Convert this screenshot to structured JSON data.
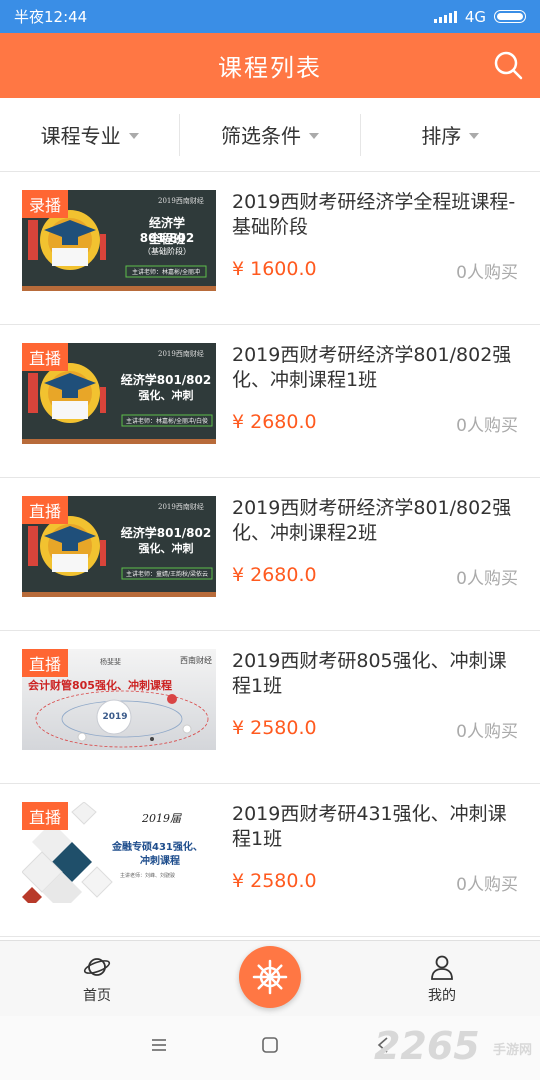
{
  "status_bar": {
    "time": "半夜12:44",
    "network": "4G"
  },
  "header": {
    "title": "课程列表"
  },
  "filters": [
    {
      "label": "课程专业"
    },
    {
      "label": "筛选条件"
    },
    {
      "label": "排序"
    }
  ],
  "courses": [
    {
      "tag": "录播",
      "title": "2019西财考研经济学全程班课程-基础阶段",
      "price": "¥  1600.0",
      "buyers": "0人购买",
      "thumb": {
        "headline": "经济学801/802",
        "sub1": "全程班",
        "sub2": "（基础阶段）",
        "teacher": "主讲老师：林嘉彬/全丽冲",
        "top": "2019西南财经"
      }
    },
    {
      "tag": "直播",
      "title": "2019西财考研经济学801/802强化、冲刺课程1班",
      "price": "¥  2680.0",
      "buyers": "0人购买",
      "thumb": {
        "headline": "经济学801/802",
        "sub1": "强化、冲刺",
        "sub2": "",
        "teacher": "主讲老师：林嘉彬/全丽冲/白俊",
        "top": "2019西南财经"
      }
    },
    {
      "tag": "直播",
      "title": "2019西财考研经济学801/802强化、冲刺课程2班",
      "price": "¥  2680.0",
      "buyers": "0人购买",
      "thumb": {
        "headline": "经济学801/802",
        "sub1": "强化、冲刺",
        "sub2": "",
        "teacher": "主讲老师：童婧/王韵秋/梁依云",
        "top": "2019西南财经"
      }
    },
    {
      "tag": "直播",
      "title": "2019西财考研805强化、冲刺课程1班",
      "price": "¥  2580.0",
      "buyers": "0人购买",
      "thumb": {
        "headline": "会计财管805强化、冲刺课程",
        "year": "2019",
        "teacher": "杨斐斐",
        "top": "西南财经"
      }
    },
    {
      "tag": "直播",
      "title": "2019西财考研431强化、冲刺课程1班",
      "price": "¥  2580.0",
      "buyers": "0人购买",
      "thumb": {
        "headline": "金融专硕431强化、",
        "sub1": "冲刺课程",
        "year": "2019届",
        "teacher": "主讲老师：刘峰、刘骁骏"
      }
    }
  ],
  "bottom_nav": {
    "home": "首页",
    "mine": "我的"
  },
  "watermark": {
    "number": "2265",
    "suffix": "手游网"
  },
  "colors": {
    "header": "#ff7744",
    "status_bar": "#3a8ee6",
    "price": "#ff5a1f",
    "tag": "#ff6633"
  }
}
